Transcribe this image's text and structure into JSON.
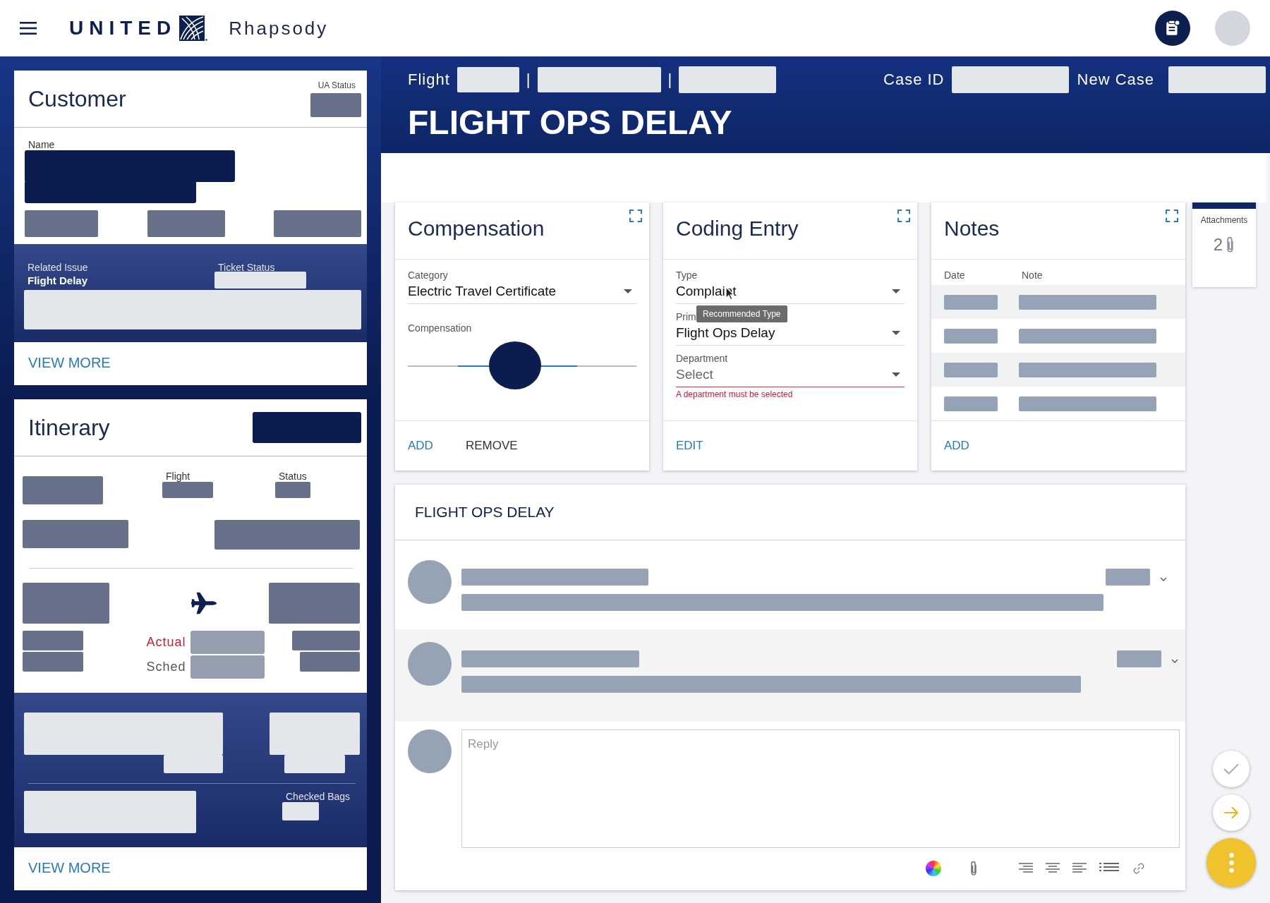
{
  "header": {
    "brand": "UNITED",
    "app_name": "Rhapsody"
  },
  "customer": {
    "title": "Customer",
    "ua_status_label": "UA Status",
    "name_label": "Name",
    "related_issue_label": "Related Issue",
    "related_issue": "Flight Delay",
    "ticket_status_label": "Ticket Status",
    "view_more": "VIEW MORE"
  },
  "itinerary": {
    "title": "Itinerary",
    "flight_label": "Flight",
    "status_label": "Status",
    "actual_label": "Actual",
    "sched_label": "Sched",
    "checked_bags_label": "Checked Bags",
    "view_more": "VIEW MORE"
  },
  "case_header": {
    "flight_label": "Flight",
    "separators": [
      "|",
      "|"
    ],
    "case_id_label": "Case ID",
    "new_case_label": "New Case",
    "title": "FLIGHT OPS DELAY"
  },
  "compensation": {
    "title": "Compensation",
    "category_label": "Category",
    "category": "Electric Travel Certificate",
    "amount_label": "Compensation",
    "level": 0.47,
    "actions": [
      {
        "label": "ADD",
        "kind": "primary"
      },
      {
        "label": "REMOVE",
        "kind": "secondary"
      }
    ]
  },
  "coding_entry": {
    "title": "Coding Entry",
    "fields": [
      {
        "label": "Type",
        "value": "Complaint"
      },
      {
        "label": "Prim",
        "value": "Flight Ops Delay"
      },
      {
        "label": "Department",
        "placeholder": "Select",
        "error": "A department must be selected"
      }
    ],
    "tooltip": "Recommended Type",
    "actions": [
      {
        "label": "EDIT",
        "kind": "primary"
      }
    ]
  },
  "notes": {
    "title": "Notes",
    "columns": [
      "Date",
      "Note"
    ],
    "actions": [
      {
        "label": "ADD",
        "kind": "primary"
      }
    ]
  },
  "attachments": {
    "label": "Attachments",
    "count": "2"
  },
  "thread": {
    "title": "FLIGHT OPS DELAY",
    "reply_placeholder": "Reply"
  }
}
